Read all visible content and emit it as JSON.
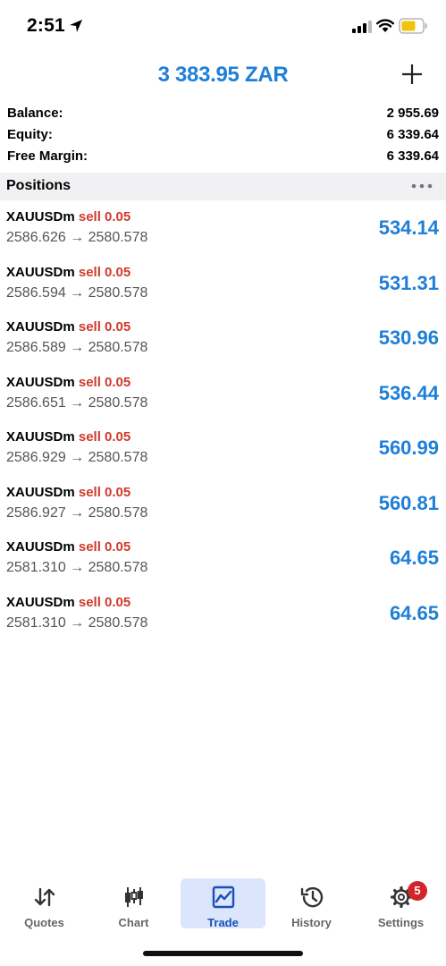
{
  "status_bar": {
    "time": "2:51"
  },
  "header": {
    "title": "3 383.95 ZAR",
    "add_icon": "plus-icon"
  },
  "summary": {
    "balance_label": "Balance:",
    "balance_value": "2 955.69",
    "equity_label": "Equity:",
    "equity_value": "6 339.64",
    "free_margin_label": "Free Margin:",
    "free_margin_value": "6 339.64"
  },
  "positions": {
    "title": "Positions",
    "more_icon": "more-dots-icon",
    "items": [
      {
        "symbol": "XAUUSDm",
        "side": "sell 0.05",
        "prices": "2586.626 → 2580.578",
        "profit": "534.14"
      },
      {
        "symbol": "XAUUSDm",
        "side": "sell 0.05",
        "prices": "2586.594 → 2580.578",
        "profit": "531.31"
      },
      {
        "symbol": "XAUUSDm",
        "side": "sell 0.05",
        "prices": "2586.589 → 2580.578",
        "profit": "530.96"
      },
      {
        "symbol": "XAUUSDm",
        "side": "sell 0.05",
        "prices": "2586.651 → 2580.578",
        "profit": "536.44"
      },
      {
        "symbol": "XAUUSDm",
        "side": "sell 0.05",
        "prices": "2586.929 → 2580.578",
        "profit": "560.99"
      },
      {
        "symbol": "XAUUSDm",
        "side": "sell 0.05",
        "prices": "2586.927 → 2580.578",
        "profit": "560.81"
      },
      {
        "symbol": "XAUUSDm",
        "side": "sell 0.05",
        "prices": "2581.310 → 2580.578",
        "profit": "64.65"
      },
      {
        "symbol": "XAUUSDm",
        "side": "sell 0.05",
        "prices": "2581.310 → 2580.578",
        "profit": "64.65"
      }
    ]
  },
  "tabs": [
    {
      "label": "Quotes",
      "icon": "quotes-arrows-icon"
    },
    {
      "label": "Chart",
      "icon": "candlestick-chart-icon"
    },
    {
      "label": "Trade",
      "icon": "trade-chart-icon",
      "active": true
    },
    {
      "label": "History",
      "icon": "history-clock-icon"
    },
    {
      "label": "Settings",
      "icon": "settings-gear-icon",
      "badge": "5"
    }
  ],
  "colors": {
    "accent_blue": "#1e7fd9",
    "sell_red": "#d03a2b",
    "active_tab_bg": "#dbe5fb",
    "badge_red": "#d2242a"
  }
}
